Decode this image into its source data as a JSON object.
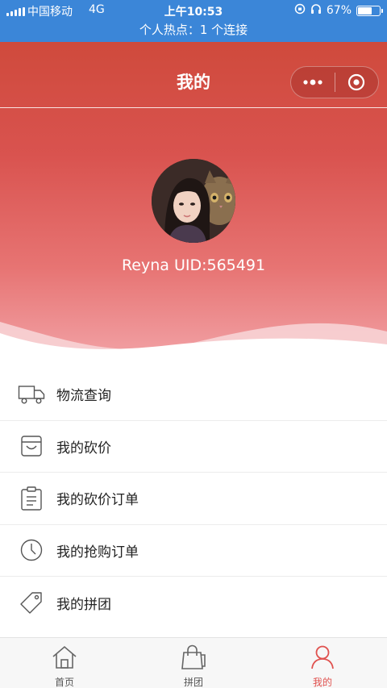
{
  "status_bar": {
    "carrier": "中国移动",
    "network": "4G",
    "time": "上午10:53",
    "battery": "67%",
    "battery_level": 0.67,
    "hotspot": "个人热点：1 个连接"
  },
  "nav": {
    "title": "我的",
    "more_icon": "more-dots-icon",
    "close_icon": "target-circle-icon"
  },
  "profile": {
    "username_line": "Reyna UID:565491"
  },
  "menu": {
    "items": [
      {
        "label": "物流查询",
        "icon": "delivery-truck-icon"
      },
      {
        "label": "我的砍价",
        "icon": "bargain-box-icon"
      },
      {
        "label": "我的砍价订单",
        "icon": "clipboard-icon"
      },
      {
        "label": "我的抢购订单",
        "icon": "clock-icon"
      },
      {
        "label": "我的拼团",
        "icon": "price-tag-icon"
      }
    ]
  },
  "tabs": [
    {
      "label": "首页",
      "icon": "home-icon",
      "active": false
    },
    {
      "label": "拼团",
      "icon": "shopping-bag-icon",
      "active": false
    },
    {
      "label": "我的",
      "icon": "user-icon",
      "active": true
    }
  ],
  "colors": {
    "status_bar": "#3b86d8",
    "header_red": "#d9534f",
    "accent": "#e0524f"
  }
}
